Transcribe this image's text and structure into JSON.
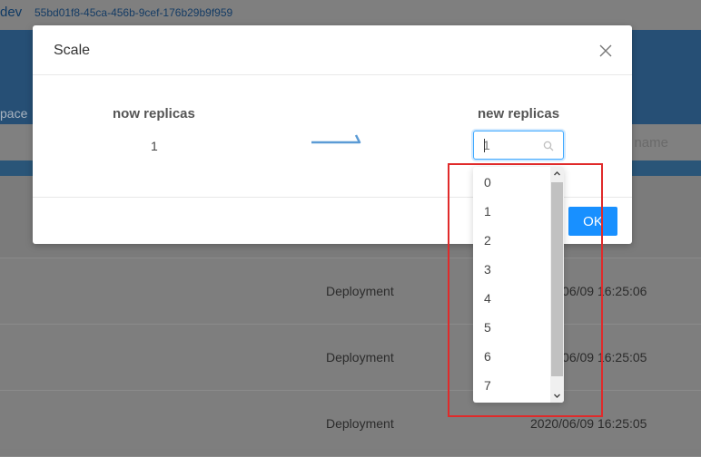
{
  "background": {
    "env_label": "dev",
    "cluster_id": "55bd01f8-45ca-456b-9cef-176b29b9f959",
    "namespace_fragment": "pace",
    "name_placeholder": "name",
    "rows": [
      {
        "kind": "Deployment",
        "time": "2020/06/09 16:25:06"
      },
      {
        "kind": "Deployment",
        "time": "2020/06/09 16:25:05"
      },
      {
        "kind": "Deployment",
        "time": "2020/06/09 16:25:05"
      }
    ]
  },
  "modal": {
    "title": "Scale",
    "close_icon": "close-icon",
    "now_replicas_label": "now replicas",
    "now_replicas_value": "1",
    "new_replicas_label": "new replicas",
    "select_value": "1",
    "ok_label": "OK"
  },
  "dropdown": {
    "options": [
      "0",
      "1",
      "2",
      "3",
      "4",
      "5",
      "6",
      "7"
    ]
  },
  "colors": {
    "primary": "#1890ff",
    "highlight": "#e02a2a",
    "arrow": "#5b9bd5"
  }
}
